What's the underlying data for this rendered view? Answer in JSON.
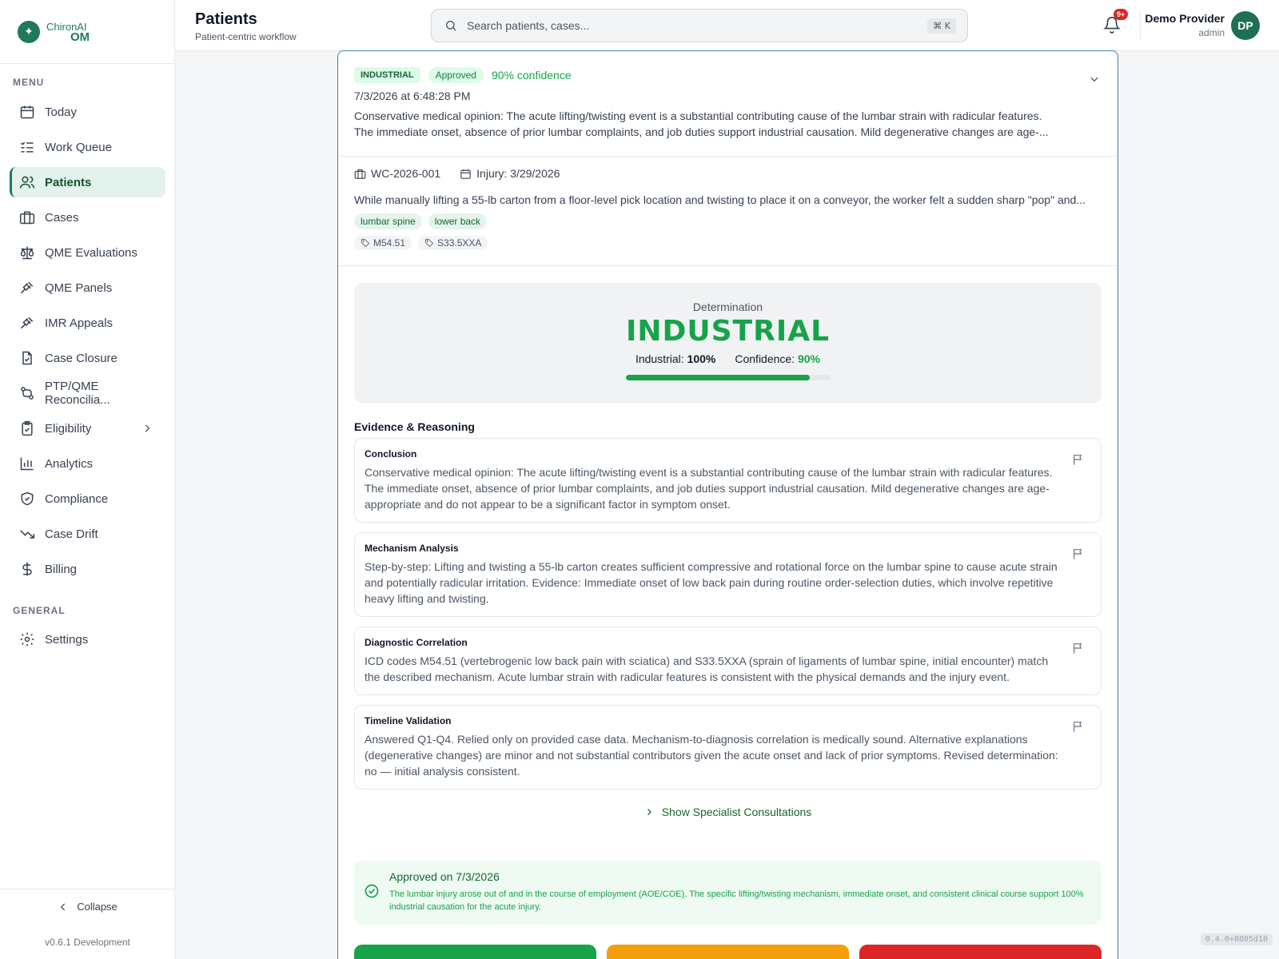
{
  "brand": {
    "logo_line1": "ChironAI",
    "logo_line2": "OM"
  },
  "sidebar": {
    "menu_title": "MENU",
    "general_title": "GENERAL",
    "items": [
      {
        "label": "Today",
        "icon": "calendar-icon"
      },
      {
        "label": "Work Queue",
        "icon": "list-check-icon"
      },
      {
        "label": "Patients",
        "icon": "users-icon",
        "active": true
      },
      {
        "label": "Cases",
        "icon": "briefcase-icon"
      },
      {
        "label": "QME Evaluations",
        "icon": "scale-icon"
      },
      {
        "label": "QME Panels",
        "icon": "gavel-icon"
      },
      {
        "label": "IMR Appeals",
        "icon": "gavel-icon"
      },
      {
        "label": "Case Closure",
        "icon": "file-check-icon"
      },
      {
        "label": "PTP/QME Reconcilia...",
        "icon": "git-compare-icon"
      },
      {
        "label": "Eligibility",
        "icon": "clipboard-check-icon"
      },
      {
        "label": "Analytics",
        "icon": "bar-chart-icon"
      },
      {
        "label": "Compliance",
        "icon": "shield-check-icon"
      },
      {
        "label": "Case Drift",
        "icon": "trending-down-icon"
      },
      {
        "label": "Billing",
        "icon": "dollar-icon"
      }
    ],
    "settings_label": "Settings",
    "collapse_label": "Collapse",
    "version": "v0.6.1 Development"
  },
  "header": {
    "title": "Patients",
    "subtitle": "Patient-centric workflow",
    "search_placeholder": "Search patients, cases...",
    "shortcut": "⌘ K",
    "notif_badge": "9+",
    "user_name": "Demo Provider",
    "user_role": "admin",
    "avatar_initials": "DP"
  },
  "card": {
    "badge_type": "INDUSTRIAL",
    "badge_status": "Approved",
    "confidence_text": "90% confidence",
    "timestamp": "7/3/2026 at 6:48:28 PM",
    "summary_line1": "Conservative medical opinion: The acute lifting/twisting event is a substantial contributing cause of the lumbar strain with radicular features.",
    "summary_line2": "The immediate onset, absence of prior lumbar complaints, and job duties support industrial causation. Mild degenerative changes are age-...",
    "case_id": "WC-2026-001",
    "injury_date": "Injury: 3/29/2026",
    "description": "While manually lifting a 55-lb carton from a floor-level pick location and twisting to place it on a conveyor, the worker felt a sudden sharp \"pop\" and...",
    "body_parts": [
      "lumbar spine",
      "lower back"
    ],
    "codes": [
      "M54.51",
      "S33.5XXA"
    ]
  },
  "determination": {
    "label": "Determination",
    "value": "INDUSTRIAL",
    "industrial_label": "Industrial:",
    "industrial_value": "100%",
    "confidence_label": "Confidence:",
    "confidence_value": "90%",
    "confidence_fraction": 0.9
  },
  "evidence": {
    "title": "Evidence & Reasoning",
    "items": [
      {
        "heading": "Conclusion",
        "text": "Conservative medical opinion: The acute lifting/twisting event is a substantial contributing cause of the lumbar strain with radicular features. The immediate onset, absence of prior lumbar complaints, and job duties support industrial causation. Mild degenerative changes are age-appropriate and do not appear to be a significant factor in symptom onset."
      },
      {
        "heading": "Mechanism Analysis",
        "text": "Step-by-step: Lifting and twisting a 55-lb carton creates sufficient compressive and rotational force on the lumbar spine to cause acute strain and potentially radicular irritation. Evidence: Immediate onset of low back pain during routine order-selection duties, which involve repetitive heavy lifting and twisting."
      },
      {
        "heading": "Diagnostic Correlation",
        "text": "ICD codes M54.51 (vertebrogenic low back pain with sciatica) and S33.5XXA (sprain of ligaments of lumbar spine, initial encounter) match the described mechanism. Acute lumbar strain with radicular features is consistent with the physical demands and the injury event."
      },
      {
        "heading": "Timeline Validation",
        "text": "Answered Q1-Q4. Relied only on provided case data. Mechanism-to-diagnosis correlation is medically sound. Alternative explanations (degenerative changes) are minor and not substantial contributors given the acute onset and lack of prior symptoms. Revised determination: no — initial analysis consistent."
      }
    ]
  },
  "specialist_label": "Show Specialist Consultations",
  "approval": {
    "title": "Approved on 7/3/2026",
    "text": "The lumbar injury arose out of and in the course of employment (AOE/COE). The specific lifting/twisting mechanism, immediate onset, and consistent clinical course support 100% industrial causation for the acute injury."
  },
  "build_tag": "0.4.0+8805d10",
  "colors": {
    "brand": "#1f7a5a",
    "success": "#16a34a",
    "warning": "#f59e0b",
    "danger": "#dc2626"
  }
}
